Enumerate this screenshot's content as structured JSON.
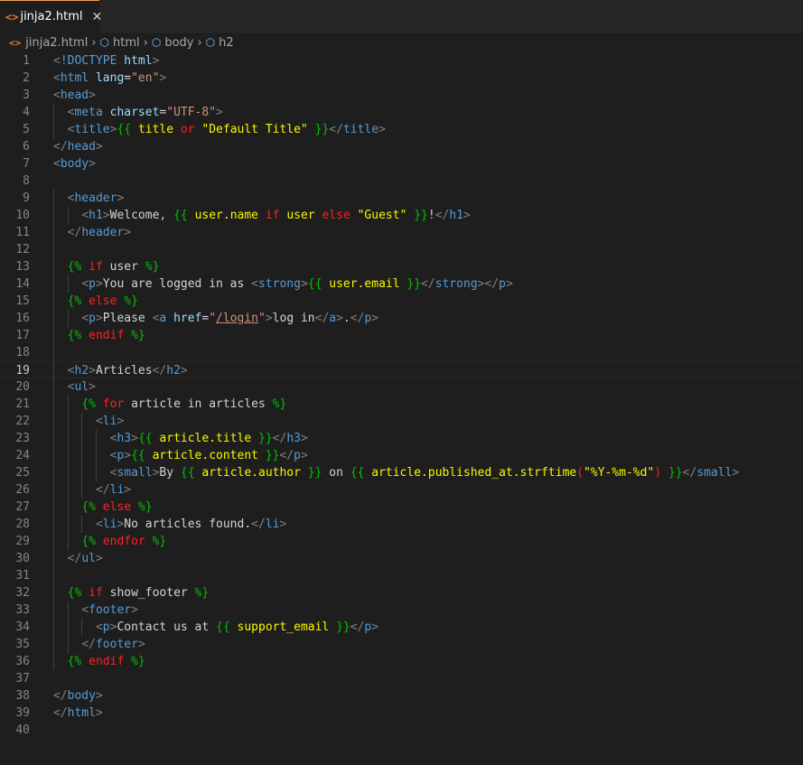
{
  "tab": {
    "icon": "html-file-icon",
    "label": "jinja2.html",
    "close": "✕"
  },
  "breadcrumb": [
    {
      "label": "jinja2.html",
      "icon": "html-file-icon"
    },
    {
      "label": "html",
      "icon": "symbol-element-icon"
    },
    {
      "label": "body",
      "icon": "symbol-element-icon"
    },
    {
      "label": "h2",
      "icon": "symbol-element-icon"
    }
  ],
  "editor": {
    "current_line": 19,
    "lines": [
      {
        "n": 1,
        "indent": 0,
        "tokens": [
          [
            "br",
            "<"
          ],
          [
            "tag",
            "!DOCTYPE "
          ],
          [
            "attr",
            "html"
          ],
          [
            "br",
            ">"
          ]
        ]
      },
      {
        "n": 2,
        "indent": 0,
        "tokens": [
          [
            "br",
            "<"
          ],
          [
            "tag",
            "html "
          ],
          [
            "attr",
            "lang"
          ],
          [
            "txt",
            "="
          ],
          [
            "str",
            "\"en\""
          ],
          [
            "br",
            ">"
          ]
        ]
      },
      {
        "n": 3,
        "indent": 0,
        "tokens": [
          [
            "br",
            "<"
          ],
          [
            "tag",
            "head"
          ],
          [
            "br",
            ">"
          ]
        ]
      },
      {
        "n": 4,
        "indent": 1,
        "tokens": [
          [
            "br",
            "<"
          ],
          [
            "tag",
            "meta "
          ],
          [
            "attr",
            "charset"
          ],
          [
            "txt",
            "="
          ],
          [
            "str",
            "\"UTF-8\""
          ],
          [
            "br",
            ">"
          ]
        ]
      },
      {
        "n": 5,
        "indent": 1,
        "tokens": [
          [
            "br",
            "<"
          ],
          [
            "tag",
            "title"
          ],
          [
            "br",
            ">"
          ],
          [
            "jd",
            "{{ "
          ],
          [
            "jv",
            "title "
          ],
          [
            "jk",
            "or "
          ],
          [
            "jv",
            "\"Default Title\" "
          ],
          [
            "jd",
            "}}"
          ],
          [
            "br",
            "</"
          ],
          [
            "tag",
            "title"
          ],
          [
            "br",
            ">"
          ]
        ]
      },
      {
        "n": 6,
        "indent": 0,
        "tokens": [
          [
            "br",
            "</"
          ],
          [
            "tag",
            "head"
          ],
          [
            "br",
            ">"
          ]
        ]
      },
      {
        "n": 7,
        "indent": 0,
        "tokens": [
          [
            "br",
            "<"
          ],
          [
            "tag",
            "body"
          ],
          [
            "br",
            ">"
          ]
        ]
      },
      {
        "n": 8,
        "indent": 0,
        "tokens": []
      },
      {
        "n": 9,
        "indent": 1,
        "tokens": [
          [
            "br",
            "<"
          ],
          [
            "tag",
            "header"
          ],
          [
            "br",
            ">"
          ]
        ]
      },
      {
        "n": 10,
        "indent": 2,
        "tokens": [
          [
            "br",
            "<"
          ],
          [
            "tag",
            "h1"
          ],
          [
            "br",
            ">"
          ],
          [
            "txt",
            "Welcome, "
          ],
          [
            "jd",
            "{{ "
          ],
          [
            "jv",
            "user.name "
          ],
          [
            "jk",
            "if "
          ],
          [
            "jv",
            "user "
          ],
          [
            "jk",
            "else "
          ],
          [
            "jv",
            "\"Guest\" "
          ],
          [
            "jd",
            "}}"
          ],
          [
            "txt",
            "!"
          ],
          [
            "br",
            "</"
          ],
          [
            "tag",
            "h1"
          ],
          [
            "br",
            ">"
          ]
        ]
      },
      {
        "n": 11,
        "indent": 1,
        "tokens": [
          [
            "br",
            "</"
          ],
          [
            "tag",
            "header"
          ],
          [
            "br",
            ">"
          ]
        ]
      },
      {
        "n": 12,
        "indent": 0,
        "tokens": []
      },
      {
        "n": 13,
        "indent": 1,
        "tokens": [
          [
            "jd",
            "{% "
          ],
          [
            "jk",
            "if "
          ],
          [
            "txt",
            "user "
          ],
          [
            "jd",
            "%}"
          ]
        ]
      },
      {
        "n": 14,
        "indent": 2,
        "tokens": [
          [
            "br",
            "<"
          ],
          [
            "tag",
            "p"
          ],
          [
            "br",
            ">"
          ],
          [
            "txt",
            "You are logged in as "
          ],
          [
            "br",
            "<"
          ],
          [
            "tag",
            "strong"
          ],
          [
            "br",
            ">"
          ],
          [
            "jd",
            "{{ "
          ],
          [
            "jv",
            "user.email "
          ],
          [
            "jd",
            "}}"
          ],
          [
            "br",
            "</"
          ],
          [
            "tag",
            "strong"
          ],
          [
            "br",
            "></"
          ],
          [
            "tag",
            "p"
          ],
          [
            "br",
            ">"
          ]
        ]
      },
      {
        "n": 15,
        "indent": 1,
        "tokens": [
          [
            "jd",
            "{% "
          ],
          [
            "jk",
            "else "
          ],
          [
            "jd",
            "%}"
          ]
        ]
      },
      {
        "n": 16,
        "indent": 2,
        "tokens": [
          [
            "br",
            "<"
          ],
          [
            "tag",
            "p"
          ],
          [
            "br",
            ">"
          ],
          [
            "txt",
            "Please "
          ],
          [
            "br",
            "<"
          ],
          [
            "tag",
            "a "
          ],
          [
            "attr",
            "href"
          ],
          [
            "txt",
            "="
          ],
          [
            "str",
            "\""
          ],
          [
            "url",
            "/login"
          ],
          [
            "str",
            "\""
          ],
          [
            "br",
            ">"
          ],
          [
            "txt",
            "log in"
          ],
          [
            "br",
            "</"
          ],
          [
            "tag",
            "a"
          ],
          [
            "br",
            ">"
          ],
          [
            "txt",
            "."
          ],
          [
            "br",
            "</"
          ],
          [
            "tag",
            "p"
          ],
          [
            "br",
            ">"
          ]
        ]
      },
      {
        "n": 17,
        "indent": 1,
        "tokens": [
          [
            "jd",
            "{% "
          ],
          [
            "jk",
            "endif "
          ],
          [
            "jd",
            "%}"
          ]
        ]
      },
      {
        "n": 18,
        "indent": 0,
        "tokens": []
      },
      {
        "n": 19,
        "indent": 1,
        "tokens": [
          [
            "br",
            "<"
          ],
          [
            "tag",
            "h2"
          ],
          [
            "br",
            ">"
          ],
          [
            "txt",
            "Articles"
          ],
          [
            "br",
            "</"
          ],
          [
            "tag",
            "h2"
          ],
          [
            "br",
            ">"
          ]
        ]
      },
      {
        "n": 20,
        "indent": 1,
        "tokens": [
          [
            "br",
            "<"
          ],
          [
            "tag",
            "ul"
          ],
          [
            "br",
            ">"
          ]
        ]
      },
      {
        "n": 21,
        "indent": 2,
        "tokens": [
          [
            "jd",
            "{% "
          ],
          [
            "jk",
            "for "
          ],
          [
            "txt",
            "article in articles "
          ],
          [
            "jd",
            "%}"
          ]
        ]
      },
      {
        "n": 22,
        "indent": 3,
        "tokens": [
          [
            "br",
            "<"
          ],
          [
            "tag",
            "li"
          ],
          [
            "br",
            ">"
          ]
        ]
      },
      {
        "n": 23,
        "indent": 4,
        "tokens": [
          [
            "br",
            "<"
          ],
          [
            "tag",
            "h3"
          ],
          [
            "br",
            ">"
          ],
          [
            "jd",
            "{{ "
          ],
          [
            "jv",
            "article.title "
          ],
          [
            "jd",
            "}}"
          ],
          [
            "br",
            "</"
          ],
          [
            "tag",
            "h3"
          ],
          [
            "br",
            ">"
          ]
        ]
      },
      {
        "n": 24,
        "indent": 4,
        "tokens": [
          [
            "br",
            "<"
          ],
          [
            "tag",
            "p"
          ],
          [
            "br",
            ">"
          ],
          [
            "jd",
            "{{ "
          ],
          [
            "jv",
            "article.content "
          ],
          [
            "jd",
            "}}"
          ],
          [
            "br",
            "</"
          ],
          [
            "tag",
            "p"
          ],
          [
            "br",
            ">"
          ]
        ]
      },
      {
        "n": 25,
        "indent": 4,
        "tokens": [
          [
            "br",
            "<"
          ],
          [
            "tag",
            "small"
          ],
          [
            "br",
            ">"
          ],
          [
            "txt",
            "By "
          ],
          [
            "jd",
            "{{ "
          ],
          [
            "jv",
            "article.author "
          ],
          [
            "jd",
            "}}"
          ],
          [
            "txt",
            " on "
          ],
          [
            "jd",
            "{{ "
          ],
          [
            "jv",
            "article.published_at.strftime"
          ],
          [
            "jk",
            "("
          ],
          [
            "jv",
            "\"%Y-%m-%d\""
          ],
          [
            "jk",
            ")"
          ],
          [
            "txt",
            " "
          ],
          [
            "jd",
            "}}"
          ],
          [
            "br",
            "</"
          ],
          [
            "tag",
            "small"
          ],
          [
            "br",
            ">"
          ]
        ]
      },
      {
        "n": 26,
        "indent": 3,
        "tokens": [
          [
            "br",
            "</"
          ],
          [
            "tag",
            "li"
          ],
          [
            "br",
            ">"
          ]
        ]
      },
      {
        "n": 27,
        "indent": 2,
        "tokens": [
          [
            "jd",
            "{% "
          ],
          [
            "jk",
            "else "
          ],
          [
            "jd",
            "%}"
          ]
        ]
      },
      {
        "n": 28,
        "indent": 3,
        "tokens": [
          [
            "br",
            "<"
          ],
          [
            "tag",
            "li"
          ],
          [
            "br",
            ">"
          ],
          [
            "txt",
            "No articles found."
          ],
          [
            "br",
            "</"
          ],
          [
            "tag",
            "li"
          ],
          [
            "br",
            ">"
          ]
        ]
      },
      {
        "n": 29,
        "indent": 2,
        "tokens": [
          [
            "jd",
            "{% "
          ],
          [
            "jk",
            "endfor "
          ],
          [
            "jd",
            "%}"
          ]
        ]
      },
      {
        "n": 30,
        "indent": 1,
        "tokens": [
          [
            "br",
            "</"
          ],
          [
            "tag",
            "ul"
          ],
          [
            "br",
            ">"
          ]
        ]
      },
      {
        "n": 31,
        "indent": 0,
        "tokens": []
      },
      {
        "n": 32,
        "indent": 1,
        "tokens": [
          [
            "jd",
            "{% "
          ],
          [
            "jk",
            "if "
          ],
          [
            "txt",
            "show_footer "
          ],
          [
            "jd",
            "%}"
          ]
        ]
      },
      {
        "n": 33,
        "indent": 2,
        "tokens": [
          [
            "br",
            "<"
          ],
          [
            "tag",
            "footer"
          ],
          [
            "br",
            ">"
          ]
        ]
      },
      {
        "n": 34,
        "indent": 3,
        "tokens": [
          [
            "br",
            "<"
          ],
          [
            "tag",
            "p"
          ],
          [
            "br",
            ">"
          ],
          [
            "txt",
            "Contact us at "
          ],
          [
            "jd",
            "{{ "
          ],
          [
            "jv",
            "support_email "
          ],
          [
            "jd",
            "}}"
          ],
          [
            "br",
            "</"
          ],
          [
            "tag",
            "p"
          ],
          [
            "br",
            ">"
          ]
        ]
      },
      {
        "n": 35,
        "indent": 2,
        "tokens": [
          [
            "br",
            "</"
          ],
          [
            "tag",
            "footer"
          ],
          [
            "br",
            ">"
          ]
        ]
      },
      {
        "n": 36,
        "indent": 1,
        "tokens": [
          [
            "jd",
            "{% "
          ],
          [
            "jk",
            "endif "
          ],
          [
            "jd",
            "%}"
          ]
        ]
      },
      {
        "n": 37,
        "indent": 0,
        "tokens": []
      },
      {
        "n": 38,
        "indent": 0,
        "tokens": [
          [
            "br",
            "</"
          ],
          [
            "tag",
            "body"
          ],
          [
            "br",
            ">"
          ]
        ]
      },
      {
        "n": 39,
        "indent": 0,
        "tokens": [
          [
            "br",
            "</"
          ],
          [
            "tag",
            "html"
          ],
          [
            "br",
            ">"
          ]
        ]
      },
      {
        "n": 40,
        "indent": 0,
        "tokens": []
      }
    ]
  },
  "colors": {
    "background": "#1e1e1e",
    "tab_accent": "#f0a050",
    "html_tag": "#569cd6",
    "attribute": "#9cdcfe",
    "string": "#ce9178",
    "jinja_delimiter": "#00c000",
    "jinja_keyword": "#ff2020",
    "jinja_expression": "#f8f800"
  }
}
